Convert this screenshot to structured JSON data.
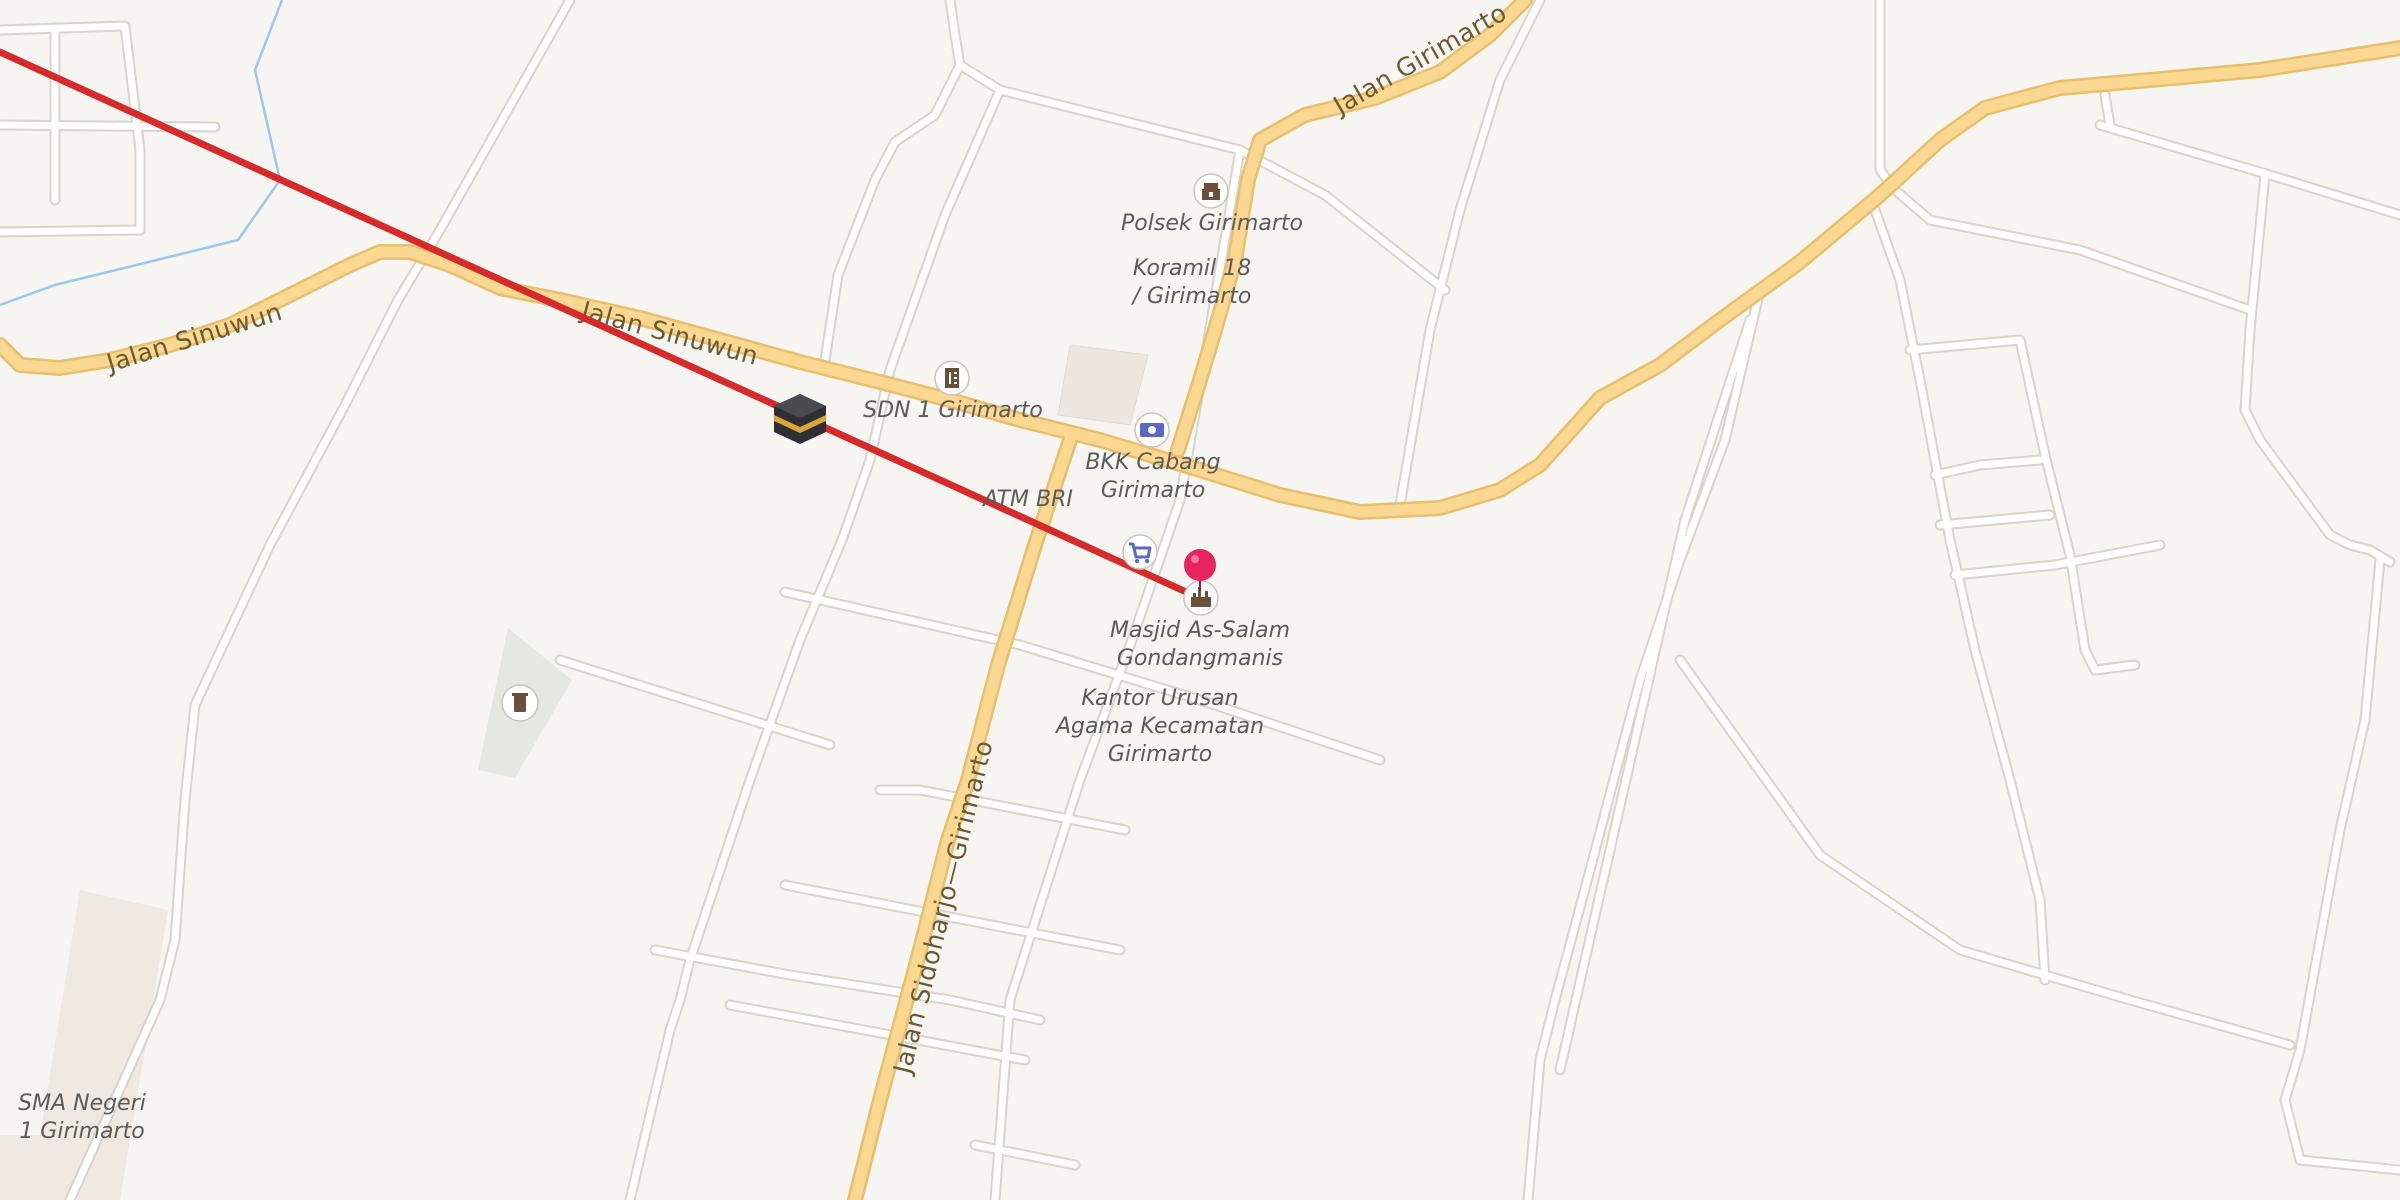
{
  "map": {
    "roads": [
      {
        "name": "Jalan Sinuwun",
        "labels": [
          "Jalan Sinuwun",
          "Jalan Sinuwun"
        ]
      },
      {
        "name": "Jalan Girimarto",
        "labels": [
          "Jalan Girimarto"
        ]
      },
      {
        "name": "Jalan Sidoharjo—Girimarto",
        "labels": [
          "Jalan Sidoharjo—Girimarto"
        ]
      }
    ],
    "places": {
      "polsek": "Polsek Girimarto",
      "koramil_line1": "Koramil 18",
      "koramil_line2": "/ Girimarto",
      "sdn": "SDN 1 Girimarto",
      "bkk_line1": "BKK Cabang",
      "bkk_line2": "Girimarto",
      "atm": "ATM BRI",
      "masjid_line1": "Masjid As-Salam",
      "masjid_line2": "Gondangmanis",
      "kua_line1": "Kantor Urusan",
      "kua_line2": "Agama Kecamatan",
      "kua_line3": "Girimarto",
      "sma_line1": "SMA Negeri",
      "sma_line2": "1 Girimarto"
    },
    "icons": [
      {
        "name": "police-icon",
        "place": "Polsek Girimarto"
      },
      {
        "name": "school-icon",
        "place": "SDN 1 Girimarto"
      },
      {
        "name": "bank-icon",
        "place": "BKK Cabang Girimarto"
      },
      {
        "name": "shopping-cart-icon",
        "place": "ATM BRI"
      },
      {
        "name": "mosque-icon",
        "place": "Masjid As-Salam Gondangmanis"
      },
      {
        "name": "cemetery-icon",
        "place": "cemetery"
      },
      {
        "name": "kaaba-icon",
        "place": "qibla direction"
      },
      {
        "name": "location-pin-icon",
        "place": "selected location"
      }
    ],
    "colors": {
      "background": "#f7f5f2",
      "minor_road": "#ffffff",
      "major_road": "#fbd891",
      "major_road_casing": "#e8bf6c",
      "qibla_line": "#d72b2b",
      "pin": "#e8245f",
      "waterway": "#9cc8ec",
      "icon_brown": "#6b4f3a",
      "icon_blue": "#5b67c4"
    }
  }
}
